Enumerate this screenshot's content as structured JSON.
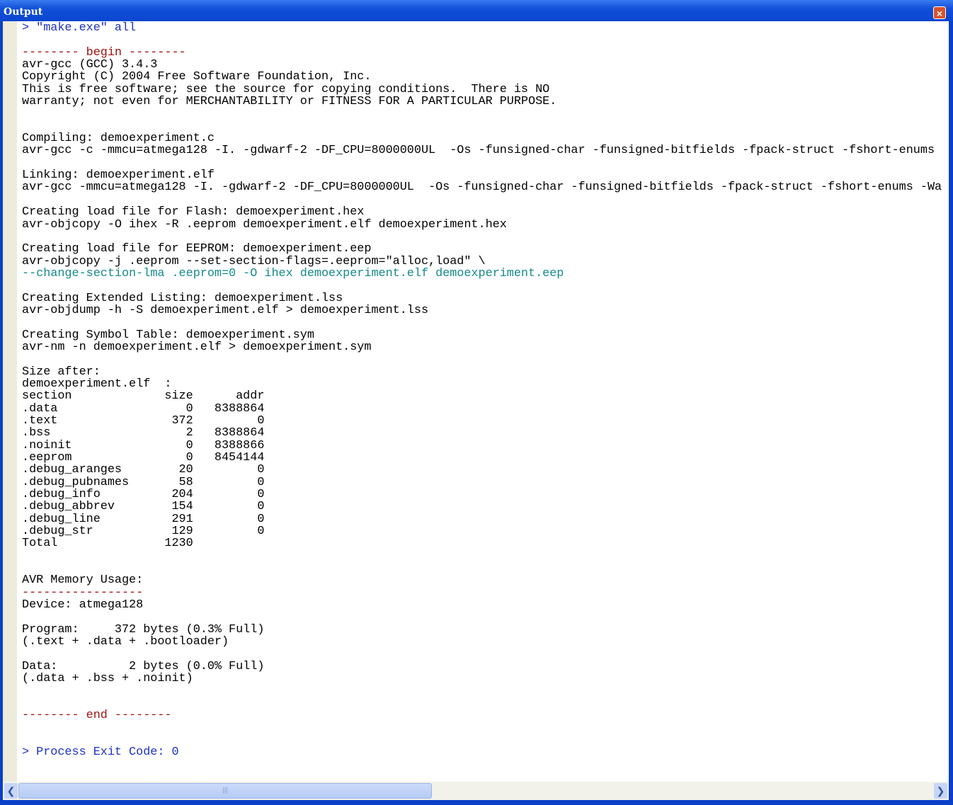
{
  "window": {
    "title": "Output",
    "close_icon": "close-icon"
  },
  "lines": [
    {
      "t": "> \"make.exe\" all",
      "c": "blue"
    },
    {
      "t": "",
      "c": ""
    },
    {
      "t": "-------- begin --------",
      "c": "red"
    },
    {
      "t": "avr-gcc (GCC) 3.4.3",
      "c": ""
    },
    {
      "t": "Copyright (C) 2004 Free Software Foundation, Inc.",
      "c": ""
    },
    {
      "t": "This is free software; see the source for copying conditions.  There is NO",
      "c": ""
    },
    {
      "t": "warranty; not even for MERCHANTABILITY or FITNESS FOR A PARTICULAR PURPOSE.",
      "c": ""
    },
    {
      "t": "",
      "c": ""
    },
    {
      "t": "",
      "c": ""
    },
    {
      "t": "Compiling: demoexperiment.c",
      "c": ""
    },
    {
      "t": "avr-gcc -c -mmcu=atmega128 -I. -gdwarf-2 -DF_CPU=8000000UL  -Os -funsigned-char -funsigned-bitfields -fpack-struct -fshort-enums",
      "c": ""
    },
    {
      "t": "",
      "c": ""
    },
    {
      "t": "Linking: demoexperiment.elf",
      "c": ""
    },
    {
      "t": "avr-gcc -mmcu=atmega128 -I. -gdwarf-2 -DF_CPU=8000000UL  -Os -funsigned-char -funsigned-bitfields -fpack-struct -fshort-enums -Wa",
      "c": ""
    },
    {
      "t": "",
      "c": ""
    },
    {
      "t": "Creating load file for Flash: demoexperiment.hex",
      "c": ""
    },
    {
      "t": "avr-objcopy -O ihex -R .eeprom demoexperiment.elf demoexperiment.hex",
      "c": ""
    },
    {
      "t": "",
      "c": ""
    },
    {
      "t": "Creating load file for EEPROM: demoexperiment.eep",
      "c": ""
    },
    {
      "t": "avr-objcopy -j .eeprom --set-section-flags=.eeprom=\"alloc,load\" \\",
      "c": ""
    },
    {
      "t": "--change-section-lma .eeprom=0 -O ihex demoexperiment.elf demoexperiment.eep",
      "c": "teal"
    },
    {
      "t": "",
      "c": ""
    },
    {
      "t": "Creating Extended Listing: demoexperiment.lss",
      "c": ""
    },
    {
      "t": "avr-objdump -h -S demoexperiment.elf > demoexperiment.lss",
      "c": ""
    },
    {
      "t": "",
      "c": ""
    },
    {
      "t": "Creating Symbol Table: demoexperiment.sym",
      "c": ""
    },
    {
      "t": "avr-nm -n demoexperiment.elf > demoexperiment.sym",
      "c": ""
    },
    {
      "t": "",
      "c": ""
    },
    {
      "t": "Size after:",
      "c": ""
    },
    {
      "t": "demoexperiment.elf  :",
      "c": ""
    },
    {
      "t": "section             size      addr",
      "c": ""
    },
    {
      "t": ".data                  0   8388864",
      "c": ""
    },
    {
      "t": ".text                372         0",
      "c": ""
    },
    {
      "t": ".bss                   2   8388864",
      "c": ""
    },
    {
      "t": ".noinit                0   8388866",
      "c": ""
    },
    {
      "t": ".eeprom                0   8454144",
      "c": ""
    },
    {
      "t": ".debug_aranges        20         0",
      "c": ""
    },
    {
      "t": ".debug_pubnames       58         0",
      "c": ""
    },
    {
      "t": ".debug_info          204         0",
      "c": ""
    },
    {
      "t": ".debug_abbrev        154         0",
      "c": ""
    },
    {
      "t": ".debug_line          291         0",
      "c": ""
    },
    {
      "t": ".debug_str           129         0",
      "c": ""
    },
    {
      "t": "Total               1230",
      "c": ""
    },
    {
      "t": "",
      "c": ""
    },
    {
      "t": "",
      "c": ""
    },
    {
      "t": "AVR Memory Usage:",
      "c": ""
    },
    {
      "t": "-----------------",
      "c": "red"
    },
    {
      "t": "Device: atmega128",
      "c": ""
    },
    {
      "t": "",
      "c": ""
    },
    {
      "t": "Program:     372 bytes (0.3% Full)",
      "c": ""
    },
    {
      "t": "(.text + .data + .bootloader)",
      "c": ""
    },
    {
      "t": "",
      "c": ""
    },
    {
      "t": "Data:          2 bytes (0.0% Full)",
      "c": ""
    },
    {
      "t": "(.data + .bss + .noinit)",
      "c": ""
    },
    {
      "t": "",
      "c": ""
    },
    {
      "t": "",
      "c": ""
    },
    {
      "t": "-------- end --------",
      "c": "red"
    },
    {
      "t": "",
      "c": ""
    },
    {
      "t": "",
      "c": ""
    },
    {
      "t": "> Process Exit Code: 0",
      "c": "blue"
    }
  ],
  "scrollbar": {
    "position_fraction": 0.0,
    "visible_fraction": 0.45
  }
}
